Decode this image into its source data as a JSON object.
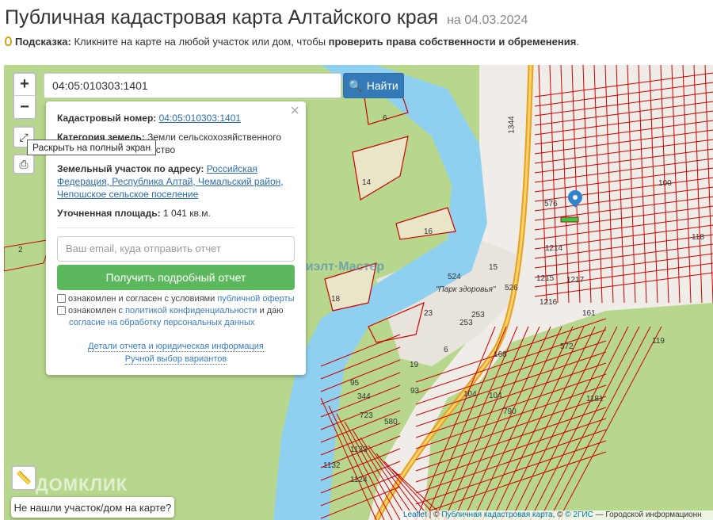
{
  "header": {
    "title": "Публичная кадастровая карта Алтайского края",
    "date": "на 04.03.2024"
  },
  "hint": {
    "label": "Подсказка:",
    "text": " Кликните на карте на любой участок или дом, чтобы ",
    "bold": "проверить права собственности и обременения",
    "end": "."
  },
  "search": {
    "value": "04:05:010303:1401",
    "button": "Найти"
  },
  "controls": {
    "zoom_in": "+",
    "zoom_out": "−",
    "fullscreen_tooltip": "Раскрыть на полный экран"
  },
  "popup": {
    "cad_label": "Кадастровый номер:",
    "cad_value": "04:05:010303:1401",
    "cat_label": "Категория земель:",
    "cat_value": "Земли сельскохозяйственного",
    "use": "Под дачное строительство",
    "addr_label": "Земельный участок по адресу:",
    "addr_value": "Российская Федерация, Республика Алтай, Чемальский район, Чепошское сельское поселение",
    "area_label": "Уточненная площадь:",
    "area_value": "1 041 кв.м.",
    "email_placeholder": "Ваш email, куда отправить отчет",
    "get_report": "Получить подробный отчет",
    "chk1_text": "ознакомлен и согласен с условиями ",
    "chk1_link": "публичной оферты",
    "chk2_text": "ознакомлен с ",
    "chk2_link": "политикой конфиденциальности",
    "chk2_mid": " и даю ",
    "chk2_link2": "согласие на обработку персональных данных",
    "details_link": "Детали отчета и юридическая информация",
    "manual_link": "Ручной выбор вариантов"
  },
  "not_found": "Не нашли участок/дом на карте?",
  "watermarks": {
    "rielt": "Риэлт·Мастер",
    "domclick": "ДОМКЛИК"
  },
  "attribution": {
    "leaflet": "Leaflet",
    "sep": " | © ",
    "pkk": "Публичная кадастровая карта",
    "mid": ", © ",
    "gis": "© 2ГИС",
    "rest": " — Городской информационн"
  },
  "map_labels": [
    "6",
    "14",
    "16",
    "18",
    "2",
    "1344",
    "576",
    "100",
    "1214",
    "1215",
    "1217",
    "1216",
    "118",
    "161",
    "119",
    "572",
    "524",
    "526",
    "15",
    "253",
    "253",
    "23",
    "6",
    "19",
    "95",
    "344",
    "93",
    "723",
    "580",
    "104",
    "104",
    "790",
    "1181",
    "168",
    "1133",
    "1132",
    "1124",
    "\"Парк здоровья\""
  ]
}
